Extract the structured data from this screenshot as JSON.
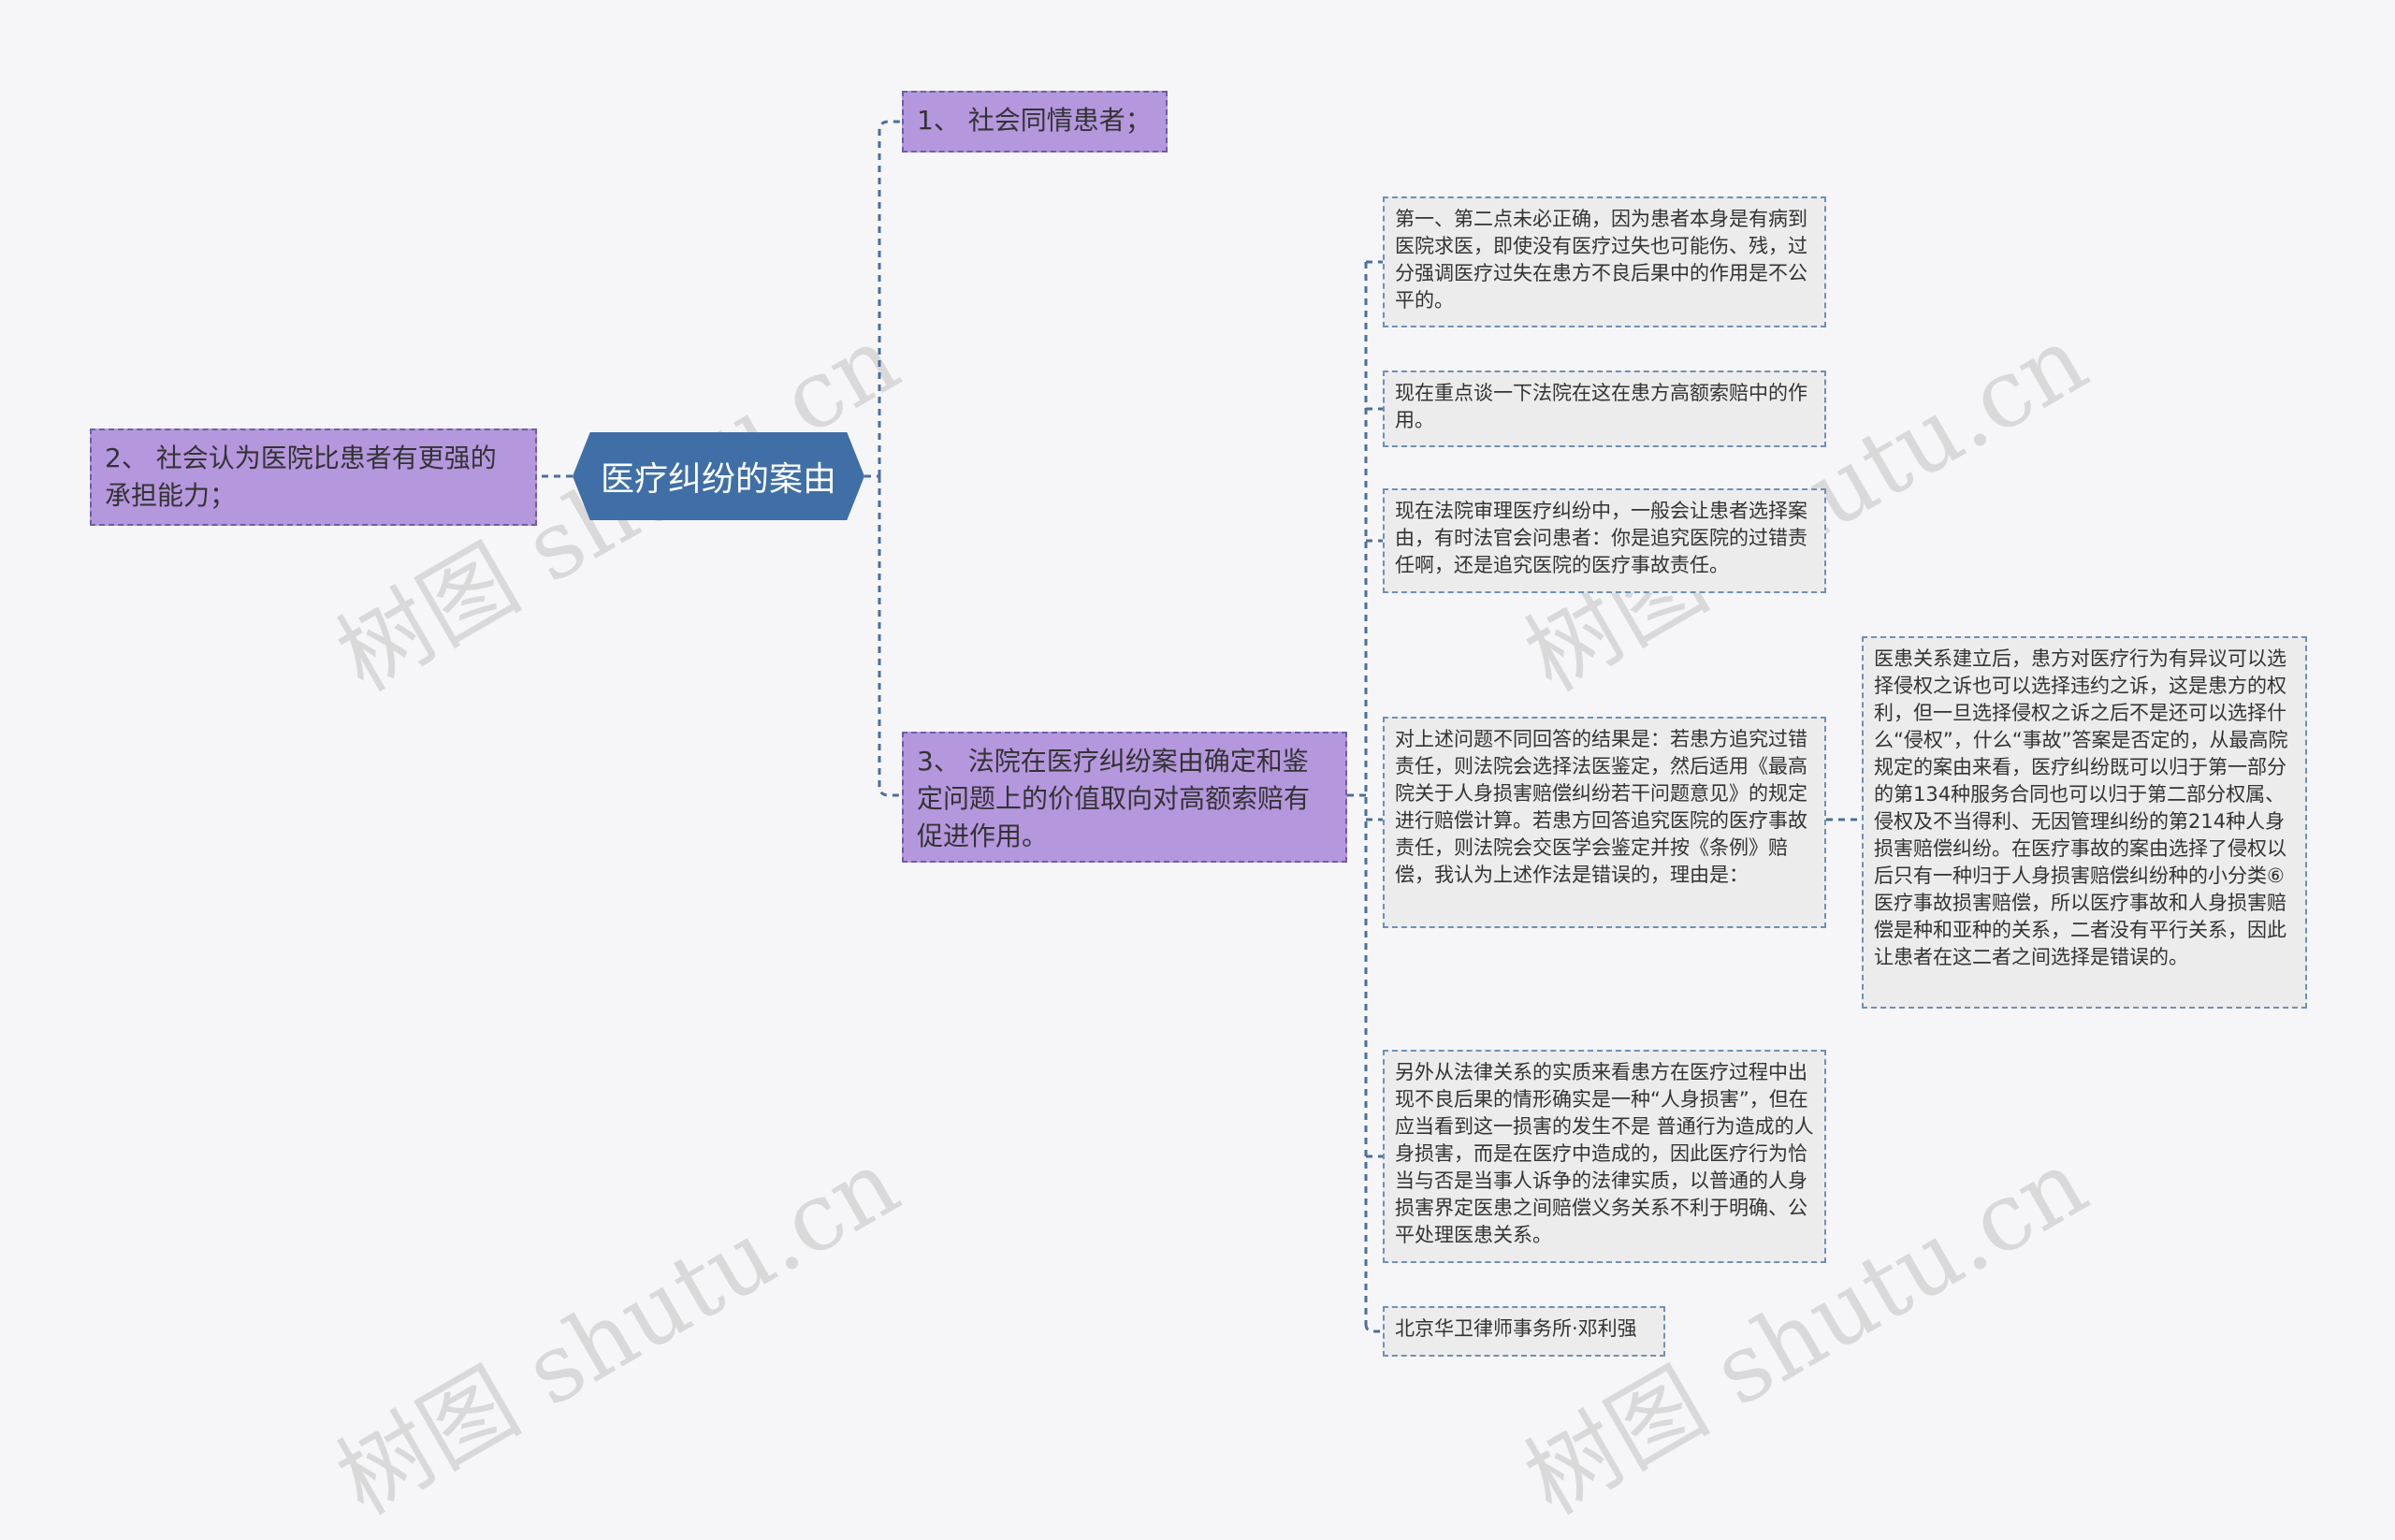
{
  "root": {
    "label": "医疗纠纷的案由"
  },
  "branches": {
    "b1": "1、 社会同情患者；",
    "b2": "2、 社会认为医院比患者有更强的承担能力；",
    "b3": "3、 法院在医疗纠纷案由确定和鉴定问题上的价值取向对高额索赔有促进作用。"
  },
  "leaves": {
    "l1": "第一、第二点未必正确，因为患者本身是有病到医院求医，即使没有医疗过失也可能伤、残，过分强调医疗过失在患方不良后果中的作用是不公平的。",
    "l2": "现在重点谈一下法院在这在患方高额索赔中的作用。",
    "l3": "现在法院审理医疗纠纷中，一般会让患者选择案由，有时法官会问患者：你是追究医院的过错责任啊，还是追究医院的医疗事故责任。",
    "l4": "对上述问题不同回答的结果是：若患方追究过错责任，则法院会选择法医鉴定，然后适用《最高院关于人身损害赔偿纠纷若干问题意见》的规定进行赔偿计算。若患方回答追究医院的医疗事故责任，则法院会交医学会鉴定并按《条例》赔偿，我认为上述作法是错误的，理由是：",
    "l5": "另外从法律关系的实质来看患方在医疗过程中出现不良后果的情形确实是一种“人身损害”，但在应当看到这一损害的发生不是 普通行为造成的人身损害，而是在医疗中造成的，因此医疗行为恰当与否是当事人诉争的法律实质，以普通的人身损害界定医患之间赔偿义务关系不利于明确、公平处理医患关系。",
    "l6": "北京华卫律师事务所·邓利强",
    "l4a": "医患关系建立后，患方对医疗行为有异议可以选择侵权之诉也可以选择违约之诉，这是患方的权利，但一旦选择侵权之诉之后不是还可以选择什么“侵权”，什么“事故”答案是否定的，从最高院规定的案由来看，医疗纠纷既可以归于第一部分的第134种服务合同也可以归于第二部分权属、侵权及不当得利、无因管理纠纷的第214种人身损害赔偿纠纷。在医疗事故的案由选择了侵权以后只有一种归于人身损害赔偿纠纷种的小分类⑥医疗事故损害赔偿，所以医疗事故和人身损害赔偿是种和亚种的关系，二者没有平行关系，因此让患者在这二者之间选择是错误的。"
  },
  "watermark": "树图 shutu.cn",
  "colors": {
    "root_fill": "#3f6fa6",
    "branch_fill": "#b597de",
    "leaf_fill": "#ececec",
    "connector": "#4b6f9c",
    "background": "#f6f6f8"
  }
}
